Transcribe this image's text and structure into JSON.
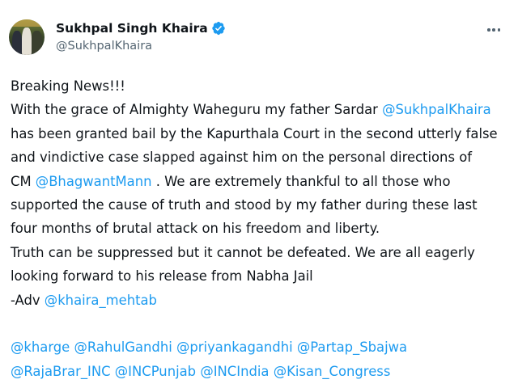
{
  "author": {
    "name": "Sukhpal Singh Khaira",
    "handle": "@SukhpalKhaira"
  },
  "colors": {
    "link": "#1d9bf0",
    "text": "#0f1419",
    "muted": "#536471"
  },
  "icons": {
    "verified": "verified-badge-icon",
    "more": "more-options-icon"
  },
  "tweet": {
    "l1": "Breaking News!!!",
    "l2a": "With the grace of Almighty Waheguru my father Sardar ",
    "m_sukhpal": "@SukhpalKhaira",
    "l3": "has been granted bail by the Kapurthala Court in the second utterly false",
    "l4": "and vindictive case slapped against him on the personal directions of",
    "l5a": "CM ",
    "m_bhagwant": "@BhagwantMann",
    "l5b": " . We are extremely thankful to all those who",
    "l6": "supported the cause of truth and stood by my father during these last",
    "l7": "four months of brutal attack on his freedom and liberty.",
    "l8": "Truth can be suppressed but it cannot be defeated. We are all eagerly",
    "l9": "looking forward to his release from Nabha Jail",
    "l10a": "-Adv ",
    "m_mehtab": "@khaira_mehtab",
    "mentions_row1": [
      "@kharge",
      "@RahulGandhi",
      "@priyankagandhi",
      "@Partap_Sbajwa"
    ],
    "mentions_row2": [
      "@RajaBrar_INC",
      "@INCPunjab",
      "@INCIndia",
      "@Kisan_Congress"
    ]
  }
}
